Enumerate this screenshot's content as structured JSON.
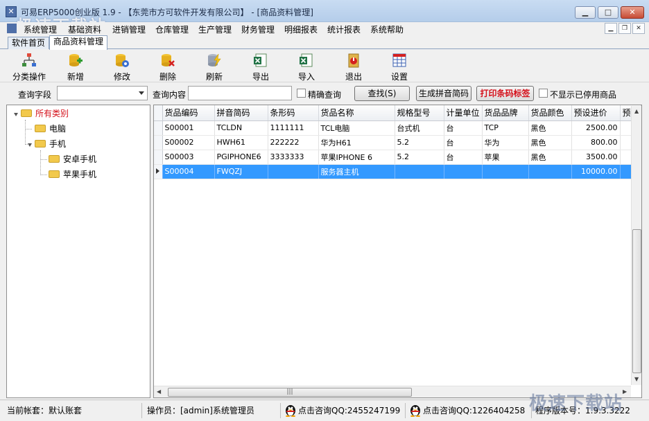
{
  "window": {
    "title": "可易ERP5000创业版 1.9 - 【东莞市方可软件开发有限公司】 - [商品资料管理]",
    "watermark": "极速下载站"
  },
  "menubar": [
    "系统管理",
    "基础资料",
    "进销管理",
    "仓库管理",
    "生产管理",
    "财务管理",
    "明细报表",
    "统计报表",
    "系统帮助"
  ],
  "tabs": [
    {
      "label": "软件首页",
      "active": false
    },
    {
      "label": "商品资料管理",
      "active": true
    }
  ],
  "toolbar": [
    {
      "label": "分类操作",
      "icon": "category-icon"
    },
    {
      "label": "新增",
      "icon": "add-icon"
    },
    {
      "label": "修改",
      "icon": "edit-icon"
    },
    {
      "label": "删除",
      "icon": "delete-icon"
    },
    {
      "label": "刷新",
      "icon": "refresh-icon"
    },
    {
      "label": "导出",
      "icon": "export-excel-icon"
    },
    {
      "label": "导入",
      "icon": "import-excel-icon"
    },
    {
      "label": "退出",
      "icon": "exit-icon"
    },
    {
      "label": "设置",
      "icon": "settings-grid-icon"
    }
  ],
  "search": {
    "field_label": "查询字段",
    "field_value": "",
    "content_label": "查询内容",
    "content_value": "",
    "exact_label": "精确查询",
    "exact_checked": false,
    "find_button": "查找(S)",
    "pinyin_button": "生成拼音简码",
    "barcode_button": "打印条码标签",
    "hide_disabled_label": "不显示已停用商品",
    "hide_disabled_checked": false
  },
  "tree": {
    "root": "所有类别",
    "nodes": [
      {
        "label": "电脑",
        "children": []
      },
      {
        "label": "手机",
        "children": [
          "安卓手机",
          "苹果手机"
        ]
      }
    ]
  },
  "grid": {
    "columns": [
      "货品编码",
      "拼音简码",
      "条形码",
      "货品名称",
      "规格型号",
      "计量单位",
      "货品品牌",
      "货品颜色",
      "预设进价",
      "预"
    ],
    "rows": [
      [
        "S00001",
        "TCLDN",
        "1111111",
        "TCL电脑",
        "台式机",
        "台",
        "TCP",
        "黑色",
        "2500.00"
      ],
      [
        "S00002",
        "HWH61",
        "222222",
        "华为H61",
        "5.2",
        "台",
        "华为",
        "黑色",
        "800.00"
      ],
      [
        "S00003",
        "PGIPHONE6",
        "3333333",
        "苹果IPHONE 6",
        "5.2",
        "台",
        "苹果",
        "黑色",
        "3500.00"
      ],
      [
        "S00004",
        "FWQZJ",
        "",
        "服务器主机",
        "",
        "",
        "",
        "",
        "10000.00"
      ]
    ],
    "selected_row": 3
  },
  "status": {
    "account": "当前帐套：默认账套",
    "operator": "操作员：[admin]系统管理员",
    "qq1": "点击咨询QQ:2455247199",
    "qq2": "点击咨询QQ:1226404258",
    "version": "程序版本号：1.9.3.3222"
  }
}
